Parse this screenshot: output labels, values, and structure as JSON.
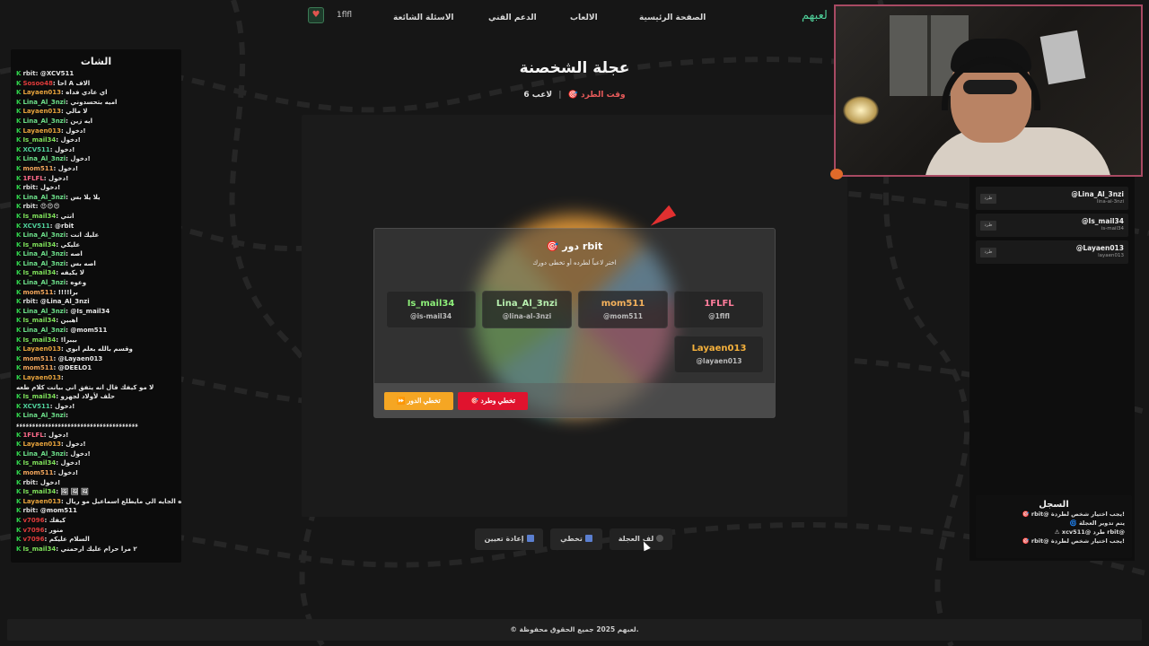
{
  "nav": {
    "user": "1flfl",
    "links": [
      "الاسئلة الشائعة",
      "الدعم الفني",
      "الالعاب",
      "الصفحة الرئيسية"
    ],
    "brand": "لعبهم"
  },
  "chat": {
    "title": "الشات",
    "messages": [
      {
        "user": "rbit",
        "text": "@XCV511",
        "color": "#dcdcdc"
      },
      {
        "user": "Sosoo48",
        "text": "احا A الاف",
        "color": "#e03b3b"
      },
      {
        "user": "Layaen013",
        "text": "اي عادي فداه",
        "color": "#e6a23c"
      },
      {
        "user": "Lina_Al_3nzi",
        "text": "اميه بتحسدوني",
        "color": "#6de08a"
      },
      {
        "user": "Layaen013",
        "text": "لا مالي",
        "color": "#e6a23c"
      },
      {
        "user": "Lina_Al_3nzi",
        "text": "ايه زين",
        "color": "#6de08a"
      },
      {
        "user": "Layaen013",
        "text": "دخول!",
        "color": "#e6a23c"
      },
      {
        "user": "Is_mail34",
        "text": "دخول!",
        "color": "#7ee05a"
      },
      {
        "user": "XCV511",
        "text": "دخول!",
        "color": "#4fd09a"
      },
      {
        "user": "Lina_Al_3nzi",
        "text": "دخول!",
        "color": "#6de08a"
      },
      {
        "user": "mom511",
        "text": "دخول!",
        "color": "#f0a45a"
      },
      {
        "user": "1FLFL",
        "text": "دخول!",
        "color": "#ff6b8a"
      },
      {
        "user": "rbit",
        "text": "دخول!",
        "color": "#dcdcdc"
      },
      {
        "user": "Lina_Al_3nzi",
        "text": "يلا يلا بس",
        "color": "#6de08a"
      },
      {
        "user": "rbit",
        "text": "😍😍😍",
        "color": "#dcdcdc"
      },
      {
        "user": "Is_mail34",
        "text": "انتي",
        "color": "#7ee05a"
      },
      {
        "user": "XCV511",
        "text": "@rbit",
        "color": "#4fd09a"
      },
      {
        "user": "Lina_Al_3nzi",
        "text": "عليك انت",
        "color": "#6de08a"
      },
      {
        "user": "Is_mail34",
        "text": "عليكي",
        "color": "#7ee05a"
      },
      {
        "user": "Lina_Al_3nzi",
        "text": "اصه",
        "color": "#6de08a"
      },
      {
        "user": "Lina_Al_3nzi",
        "text": "اصه بس",
        "color": "#6de08a"
      },
      {
        "user": "Is_mail34",
        "text": "لا يكيفه",
        "color": "#7ee05a"
      },
      {
        "user": "Lina_Al_3nzi",
        "text": "وعوه",
        "color": "#6de08a"
      },
      {
        "user": "mom511",
        "text": "!!!!برا",
        "color": "#f0a45a"
      },
      {
        "user": "rbit",
        "text": "@Lina_Al_3nzi",
        "color": "#dcdcdc"
      },
      {
        "user": "Lina_Al_3nzi",
        "text": "@Is_mail34",
        "color": "#6de08a"
      },
      {
        "user": "Is_mail34",
        "text": "اهبين",
        "color": "#7ee05a"
      },
      {
        "user": "Lina_Al_3nzi",
        "text": "@mom511",
        "color": "#6de08a"
      },
      {
        "user": "Is_mail34",
        "text": "!بيبرا",
        "color": "#7ee05a"
      },
      {
        "user": "Layaen013",
        "text": "وقسم بالله بعلم ابوي",
        "color": "#e6a23c"
      },
      {
        "user": "mom511",
        "text": "@Layaen013",
        "color": "#f0a45a"
      },
      {
        "user": "mom511",
        "text": "@DEELO1",
        "color": "#f0a45a"
      },
      {
        "user": "Layaen013",
        "text": "",
        "color": "#e6a23c"
      },
      {
        "user": "",
        "text": "لا مو كيفك قال انه يتفق اني بيانت كلام طعه",
        "color": "#dcdcdc"
      },
      {
        "user": "Is_mail34",
        "text": "حلف لأولاد لجهزو",
        "color": "#7ee05a"
      },
      {
        "user": "XCV511",
        "text": "دخول!",
        "color": "#4fd09a"
      },
      {
        "user": "Lina_Al_3nzi",
        "text": "",
        "color": "#6de08a"
      },
      {
        "user": "",
        "text": "ءءءءءءءءءءءءءءءءءءءءءءءءءءءءءءءءءءءءءء",
        "color": "#dcdcdc"
      },
      {
        "user": "1FLFL",
        "text": "دخول!",
        "color": "#ff6b8a"
      },
      {
        "user": "Layaen013",
        "text": "دخول!",
        "color": "#e6a23c"
      },
      {
        "user": "Lina_Al_3nzi",
        "text": "دخول!",
        "color": "#6de08a"
      },
      {
        "user": "Is_mail34",
        "text": "دخول!",
        "color": "#7ee05a"
      },
      {
        "user": "mom511",
        "text": "دخول!",
        "color": "#f0a45a"
      },
      {
        "user": "rbit",
        "text": "دخول!",
        "color": "#dcdcdc"
      },
      {
        "user": "Is_mail34",
        "text": "🖼 🖼 🖼",
        "color": "#7ee05a"
      },
      {
        "user": "Layaen013",
        "text": "المره الجايه الي مايطلع اسماعيل مو ريال",
        "color": "#e6a23c"
      },
      {
        "user": "rbit",
        "text": "@mom511",
        "color": "#dcdcdc"
      },
      {
        "user": "v7096",
        "text": "كيفك",
        "color": "#e03b3b"
      },
      {
        "user": "v7096",
        "text": "منور",
        "color": "#e03b3b"
      },
      {
        "user": "v7096",
        "text": "السلام عليكم",
        "color": "#e03b3b"
      },
      {
        "user": "Is_mail34",
        "text": "٢ مرا حرام عليك ارحمني",
        "color": "#7ee05a"
      }
    ]
  },
  "game": {
    "title": "عجلة الشخصنة",
    "players_label": "لاعب 6",
    "phase_label": "وقت الطرد 🎯"
  },
  "modal": {
    "title": "🎯 دور rbit",
    "subtitle": "اختر لاعباً لطرده أو تخطى دورك",
    "players": [
      {
        "name": "Is_mail34",
        "handle": "@is-mail34",
        "color": "#8ef07a"
      },
      {
        "name": "Lina_Al_3nzi",
        "handle": "@lina-al-3nzi",
        "color": "#b8f0b0"
      },
      {
        "name": "mom511",
        "handle": "@mom511",
        "color": "#f5b15c"
      },
      {
        "name": "1FLFL",
        "handle": "@1flfl",
        "color": "#ff7d9c"
      },
      {
        "name": "Layaen013",
        "handle": "@layaen013",
        "color": "#f5b13c"
      }
    ],
    "skip_turn_label": "⏩ تخطي الدور",
    "skip_kick_label": "🎯 تخطي وطرد",
    "skip_turn_color": "#f5a623",
    "skip_kick_color": "#e0132e"
  },
  "controls": {
    "reset_label": "إعادة تعيين",
    "skip_label": "تخطي",
    "spin_label": "لف العجلة"
  },
  "right_players": [
    {
      "name": "@Lina_Al_3nzi",
      "handle": "lina-al-3nzi",
      "kick": "طرد"
    },
    {
      "name": "@Is_mail34",
      "handle": "is-mail34",
      "kick": "طرد"
    },
    {
      "name": "@Layaen013",
      "handle": "layaen013",
      "kick": "طرد"
    }
  ],
  "log": {
    "title": "السجل",
    "entries": [
      "🎯 rbit@ يجب اختيار شخص لطردة!",
      "🌀 يتم تدوير العجلة",
      "⚠ xcv511@ طرد rbit@",
      "🎯 rbit@ يجب اختيار شخص لطردة!"
    ]
  },
  "footer": "© لعبهم 2025 جميع الحقوق محفوظة."
}
